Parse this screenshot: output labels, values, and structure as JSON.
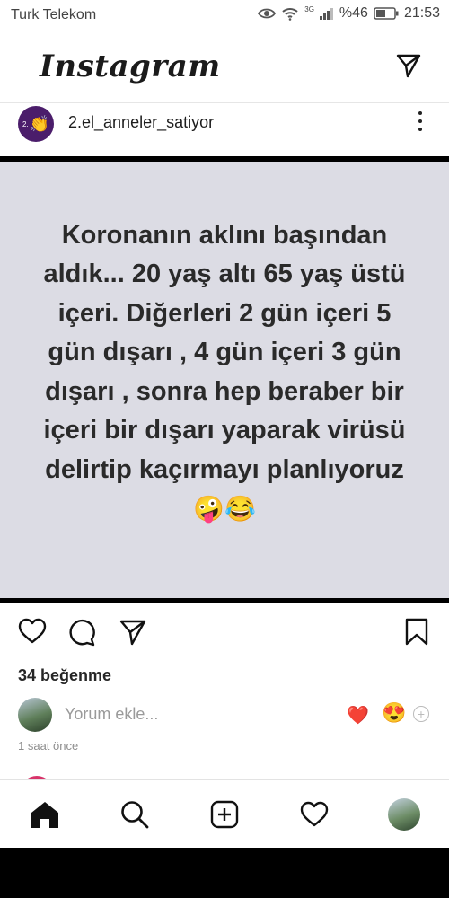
{
  "status_bar": {
    "carrier": "Turk Telekom",
    "network": "3G",
    "battery": "%46",
    "time": "21:53"
  },
  "header": {
    "logo": "Instagram",
    "direct_icon": "send-icon"
  },
  "post": {
    "username": "2.el_anneler_satiyor",
    "avatar_label": "2.",
    "avatar_emoji": "👏",
    "image_text": "Koronanın aklını başından aldık... 20 yaş altı 65 yaş üstü içeri. Diğerleri 2 gün içeri 5 gün dışarı , 4 gün içeri 3 gün dışarı , sonra hep beraber bir içeri bir dışarı yaparak virüsü delirtip kaçırmayı planlıyoruz",
    "image_emojis": "🤪😂",
    "likes": "34 beğenme",
    "comment_placeholder": "Yorum ekle...",
    "quick_reactions": [
      "❤️",
      "😍"
    ],
    "timestamp": "1 saat önce"
  },
  "colors": {
    "post_background": "#dcdce4",
    "avatar_background": "#4b1d6b",
    "reaction_heart": "#e0202f"
  }
}
